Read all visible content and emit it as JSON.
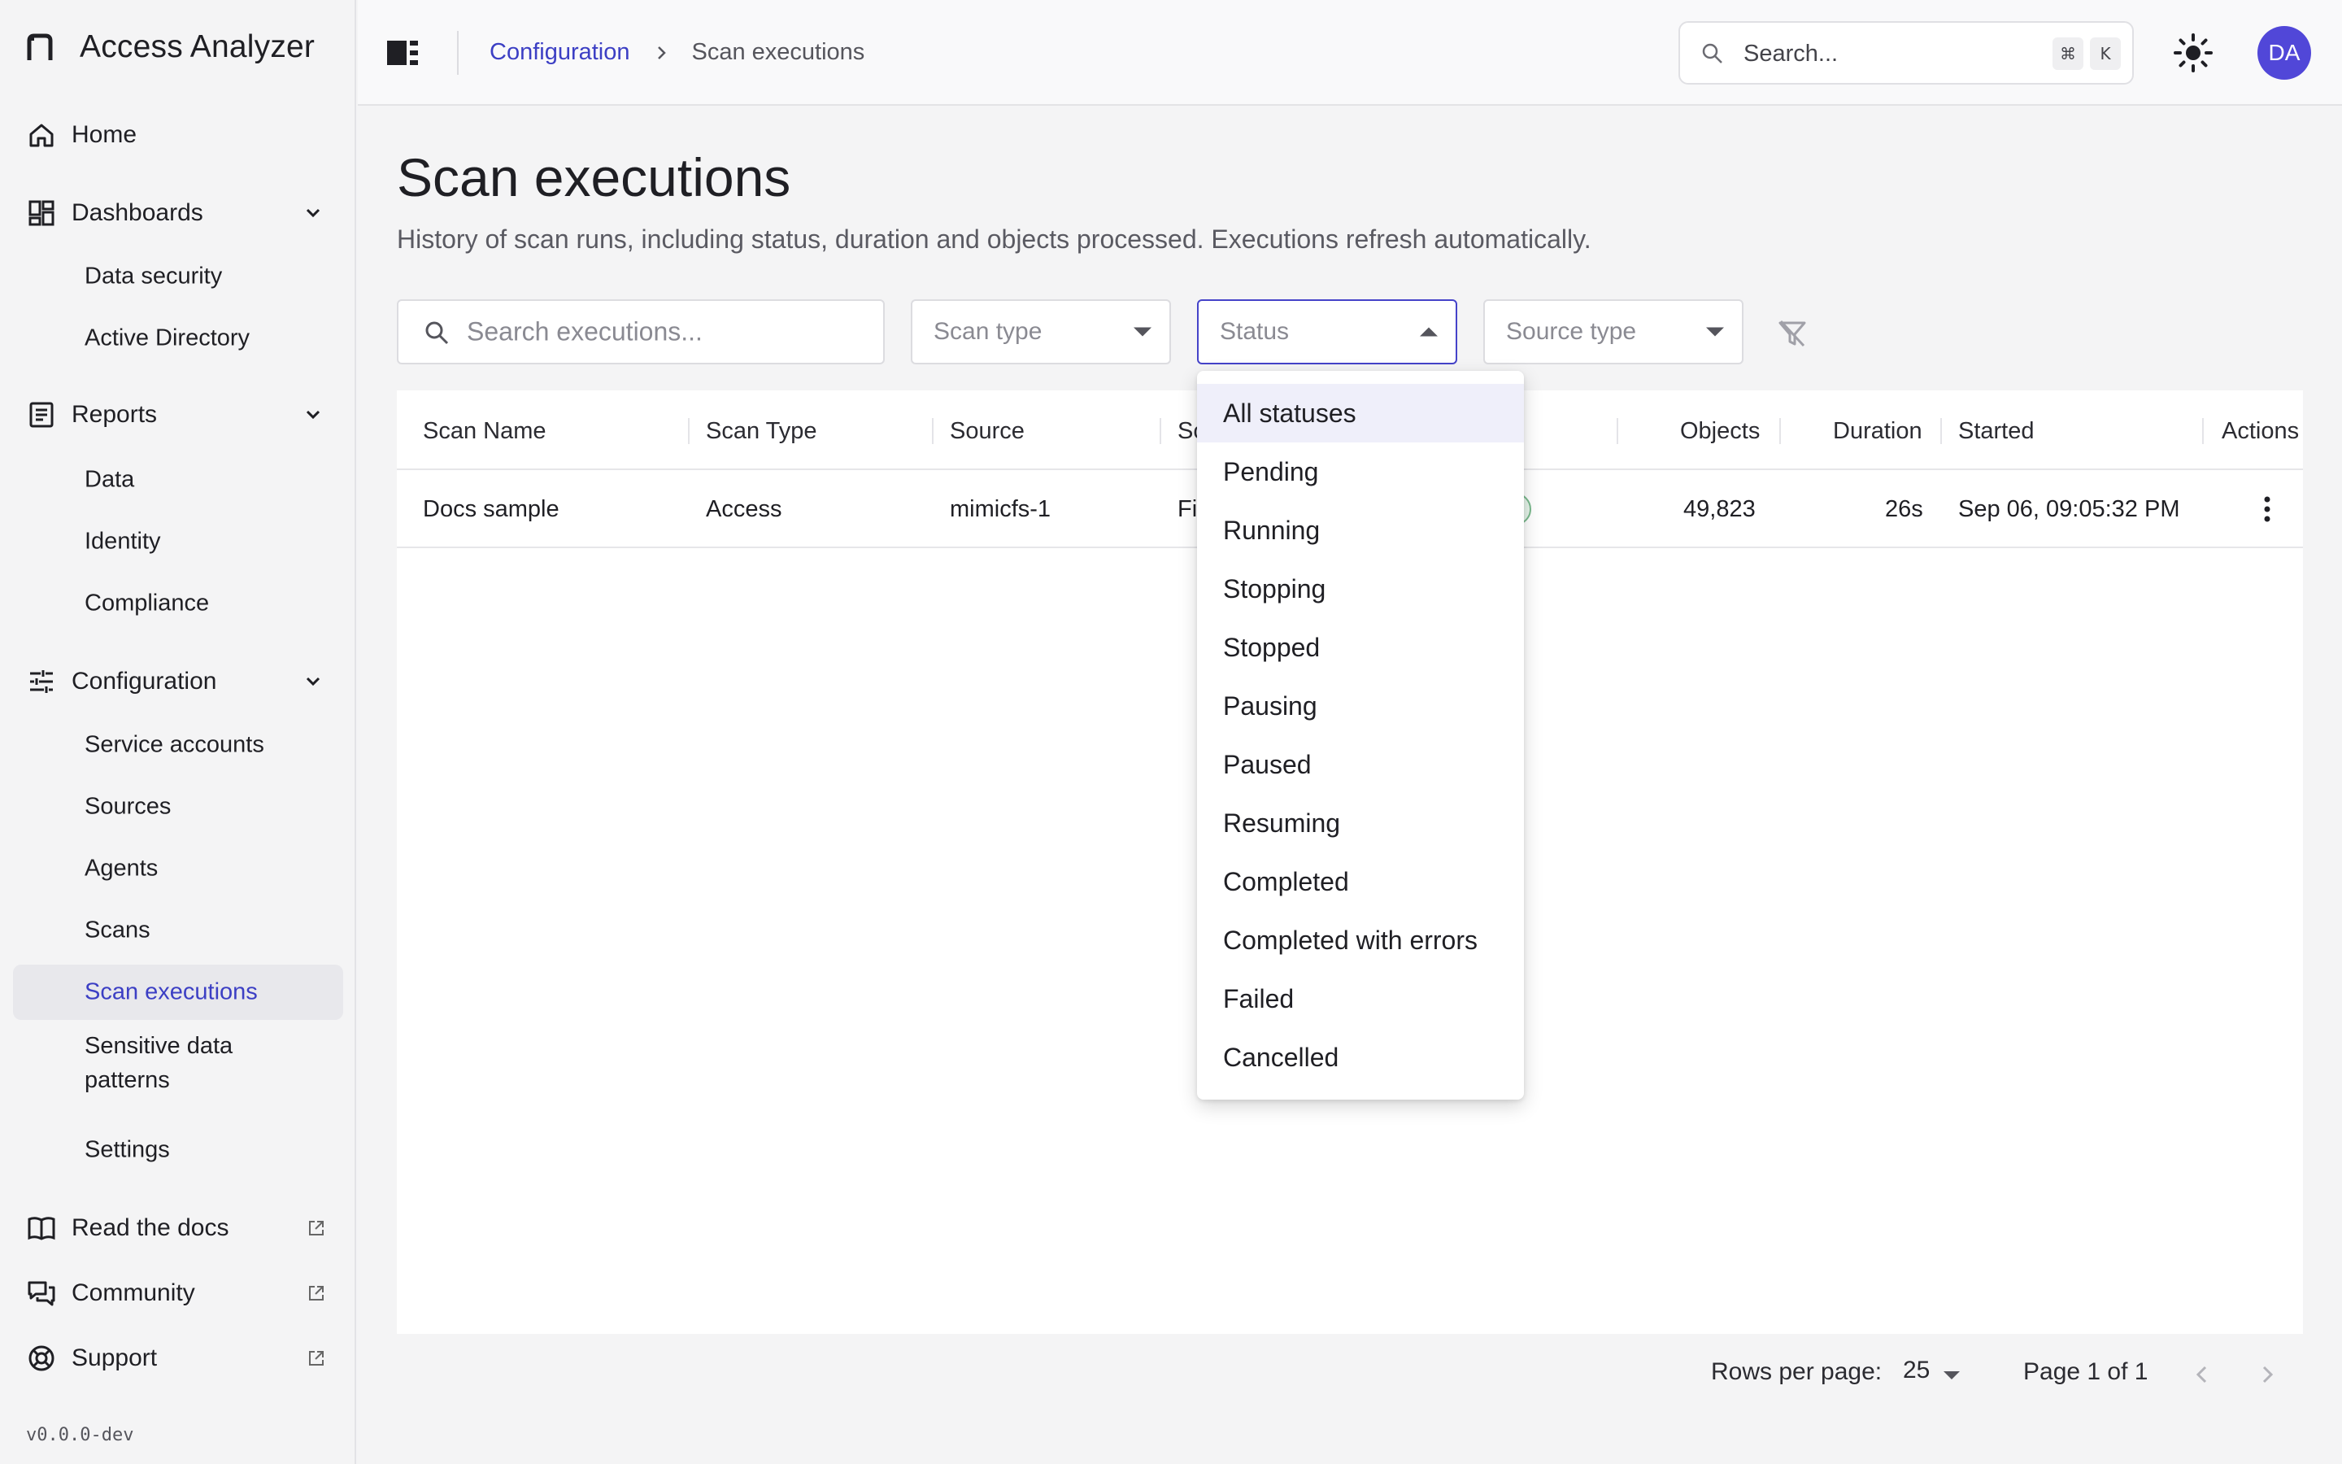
{
  "app": {
    "name": "Access Analyzer",
    "version": "v0.0.0-dev"
  },
  "sidebar": {
    "home": "Home",
    "dashboards": {
      "label": "Dashboards",
      "items": [
        "Data security",
        "Active Directory"
      ]
    },
    "reports": {
      "label": "Reports",
      "items": [
        "Data",
        "Identity",
        "Compliance"
      ]
    },
    "configuration": {
      "label": "Configuration",
      "items": [
        "Service accounts",
        "Sources",
        "Agents",
        "Scans",
        "Scan executions",
        "Sensitive data",
        "patterns",
        "Settings"
      ],
      "active": "Scan executions"
    },
    "links": [
      "Read the docs",
      "Community",
      "Support"
    ]
  },
  "header": {
    "breadcrumb": {
      "parent": "Configuration",
      "current": "Scan executions"
    },
    "search": {
      "placeholder": "Search...",
      "shortcut_mod": "⌘",
      "shortcut_key": "K"
    },
    "avatar_initials": "DA",
    "accent_color": "#3c3fc4",
    "avatar_color": "#5147d8"
  },
  "page": {
    "title": "Scan executions",
    "subtitle": "History of scan runs, including status, duration and objects processed. Executions refresh automatically."
  },
  "filters": {
    "search_placeholder": "Search executions...",
    "scan_type": "Scan type",
    "status": "Status",
    "source_type": "Source type"
  },
  "table": {
    "columns": [
      "Scan Name",
      "Scan Type",
      "Source",
      "Sc",
      "Objects",
      "Duration",
      "Started",
      "Actions"
    ],
    "rows": [
      {
        "scan_name": "Docs sample",
        "scan_type": "Access",
        "source": "mimicfs-1",
        "source_type": "Fi",
        "status": "ted",
        "objects": "49,823",
        "duration": "26s",
        "started": "Sep 06, 09:05:32 PM"
      }
    ]
  },
  "pagination": {
    "rows_per_page_label": "Rows per page:",
    "rows_per_page": "25",
    "page_info": "Page 1 of 1"
  },
  "status_dropdown": {
    "selected": "All statuses",
    "options": [
      "All statuses",
      "Pending",
      "Running",
      "Stopping",
      "Stopped",
      "Pausing",
      "Paused",
      "Resuming",
      "Completed",
      "Completed with errors",
      "Failed",
      "Cancelled"
    ]
  }
}
